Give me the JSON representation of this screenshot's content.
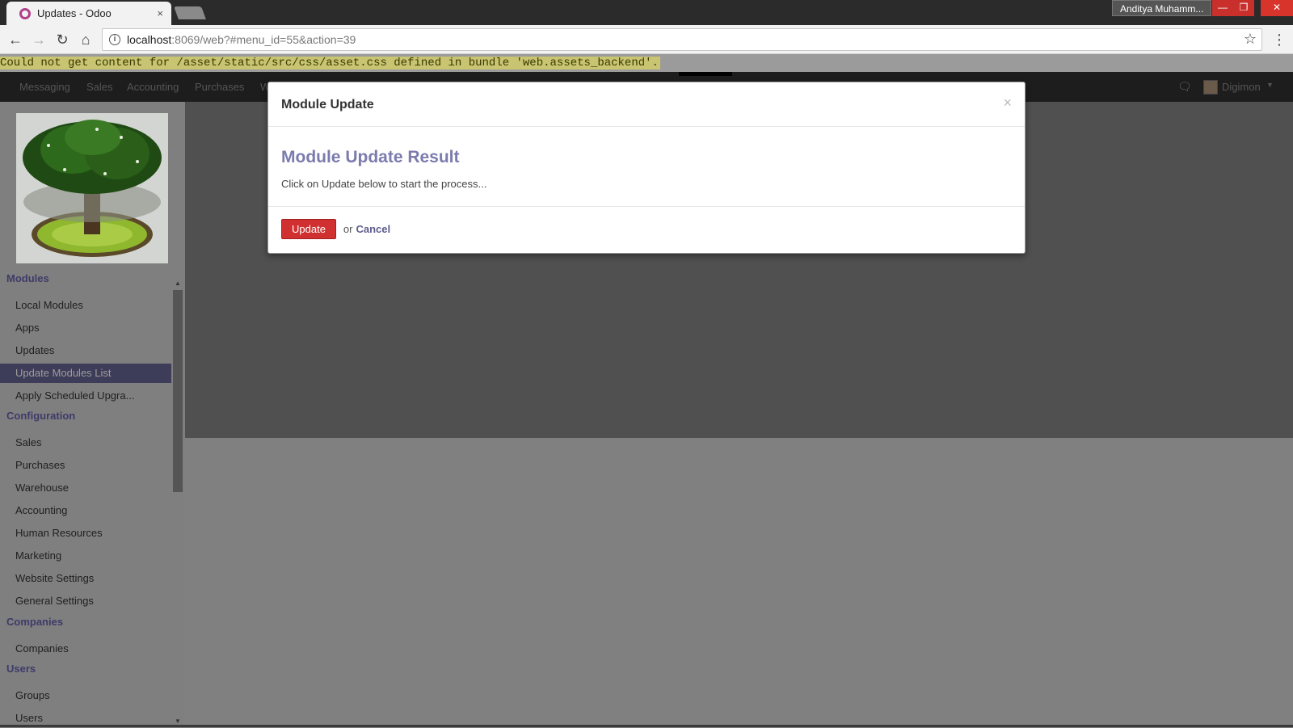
{
  "browser": {
    "tab_title": "Updates - Odoo",
    "tab_close": "×",
    "profile_name": "Anditya Muhamm...",
    "url_host": "localhost",
    "url_path": ":8069/web?#menu_id=55&action=39",
    "error_message": "Could not get content for /asset/static/src/css/asset.css defined in bundle 'web.assets_backend'."
  },
  "topmenu": {
    "items": [
      "Messaging",
      "Sales",
      "Accounting",
      "Purchases",
      "W"
    ],
    "user": "Digimon"
  },
  "sidebar": {
    "sections": [
      {
        "title": "Modules",
        "items": [
          "Local Modules",
          "Apps",
          "Updates",
          "Update Modules List",
          "Apply Scheduled Upgra..."
        ]
      },
      {
        "title": "Configuration",
        "items": [
          "Sales",
          "Purchases",
          "Warehouse",
          "Accounting",
          "Human Resources",
          "Marketing",
          "Website Settings",
          "General Settings"
        ]
      },
      {
        "title": "Companies",
        "items": [
          "Companies"
        ]
      },
      {
        "title": "Users",
        "items": [
          "Groups",
          "Users"
        ]
      }
    ],
    "active_item": "Update Modules List"
  },
  "modal": {
    "title": "Module Update",
    "close": "×",
    "result_title": "Module Update Result",
    "result_text": "Click on Update below to start the process...",
    "update_label": "Update",
    "or_label": "or",
    "cancel_label": "Cancel"
  },
  "colors": {
    "accent": "#7c7bad",
    "update_button": "#d03030",
    "active_menu": "#3e3d59"
  }
}
